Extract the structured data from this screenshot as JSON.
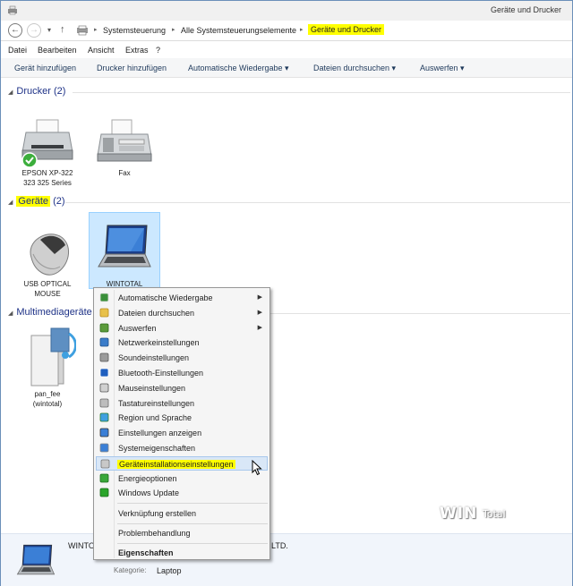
{
  "window": {
    "title": "Geräte und Drucker"
  },
  "address": {
    "back_glyph": "←",
    "forward_glyph": "→",
    "dropdown_glyph": "▾",
    "up_glyph": "↑",
    "separator": "▸",
    "crumbs": [
      "Systemsteuerung",
      "Alle Systemsteuerungselemente",
      "Geräte und Drucker"
    ]
  },
  "menubar": {
    "items": [
      "Datei",
      "Bearbeiten",
      "Ansicht",
      "Extras",
      "?"
    ]
  },
  "toolbar": {
    "add_device": "Gerät hinzufügen",
    "add_printer": "Drucker hinzufügen",
    "autoplay": "Automatische Wiedergabe ▾",
    "browse_files": "Dateien durchsuchen ▾",
    "eject": "Auswerfen ▾"
  },
  "groups": {
    "printers": {
      "label": "Drucker",
      "count": "(2)"
    },
    "devices": {
      "label": "Geräte",
      "count": "(2)"
    },
    "multimedia": {
      "label": "Multimediageräte"
    },
    "collapse_glyph": "◢"
  },
  "printers": [
    {
      "line1": "EPSON XP-322",
      "line2": "323 325 Series"
    },
    {
      "line1": "Fax"
    }
  ],
  "devices": [
    {
      "line1": "USB OPTICAL",
      "line2": "MOUSE"
    },
    {
      "line1": "WINTOTAL"
    }
  ],
  "multimedia": [
    {
      "line1": "pan_fee",
      "line2": "(wintotal)"
    }
  ],
  "context_menu": {
    "submenu_glyph": "▶",
    "items": [
      {
        "label": "Automatische Wiedergabe",
        "icon": "autoplay-icon"
      },
      {
        "label": "Dateien durchsuchen",
        "icon": "folder-icon"
      },
      {
        "label": "Auswerfen",
        "icon": "eject-icon"
      },
      {
        "label": "Netzwerkeinstellungen",
        "icon": "network-icon"
      },
      {
        "label": "Soundeinstellungen",
        "icon": "speaker-icon"
      },
      {
        "label": "Bluetooth-Einstellungen",
        "icon": "bluetooth-icon"
      },
      {
        "label": "Mauseinstellungen",
        "icon": "mouse-icon"
      },
      {
        "label": "Tastatureinstellungen",
        "icon": "keyboard-icon"
      },
      {
        "label": "Region und Sprache",
        "icon": "globe-icon"
      },
      {
        "label": "Einstellungen anzeigen",
        "icon": "display-icon"
      },
      {
        "label": "Systemeigenschaften",
        "icon": "computer-icon"
      },
      {
        "label": "Geräteinstallationseinstellungen",
        "icon": "device-install-icon"
      },
      {
        "label": "Energieoptionen",
        "icon": "power-icon"
      },
      {
        "label": "Windows Update",
        "icon": "update-icon"
      },
      {
        "label": "Verknüpfung erstellen"
      },
      {
        "label": "Problembehandlung"
      },
      {
        "label": "Eigenschaften"
      }
    ]
  },
  "details": {
    "name_partial": "WINTO",
    "name_tail": "LTD.",
    "category_key": "Kategorie:",
    "category_value": "Laptop"
  },
  "watermark": {
    "part1": "WIN",
    "part2": "Total"
  },
  "colors": {
    "highlight": "#ffff00",
    "group_header": "#1e3287",
    "selection": "#cce8ff"
  }
}
